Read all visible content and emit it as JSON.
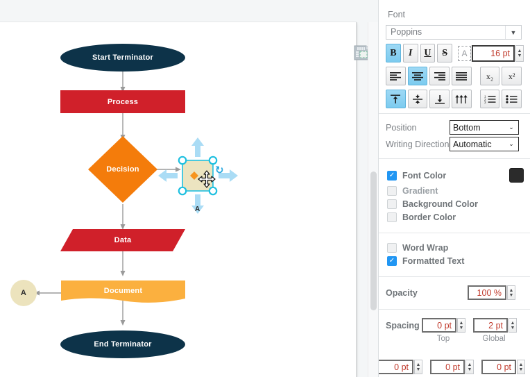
{
  "app": {
    "canvas_icon": "page-grid-icon"
  },
  "diagram": {
    "nodes": [
      {
        "id": "start",
        "label": "Start Terminator",
        "shape": "ellipse",
        "color": "#0d3349"
      },
      {
        "id": "process",
        "label": "Process",
        "shape": "rectangle",
        "color": "#d0202a"
      },
      {
        "id": "decision",
        "label": "Decision",
        "shape": "diamond",
        "color": "#f47c0b"
      },
      {
        "id": "data",
        "label": "Data",
        "shape": "parallelogram",
        "color": "#d0202a"
      },
      {
        "id": "document",
        "label": "Document",
        "shape": "document",
        "color": "#fbb03f"
      },
      {
        "id": "end",
        "label": "End Terminator",
        "shape": "ellipse",
        "color": "#0d3349"
      },
      {
        "id": "connector",
        "label": "A",
        "shape": "circle",
        "color": "#ece3bd"
      }
    ],
    "selection": {
      "label": "A",
      "fill": "#ece4c0",
      "handle_color": "#1fc0e0",
      "arrow_color": "#aadcf5",
      "marker_color": "#f7941e",
      "rotate_glyph": "↻",
      "cursor": "move-cursor"
    }
  },
  "sidebar": {
    "font": {
      "title": "Font",
      "family_value": "Poppins",
      "family_arrow": "▼",
      "style_buttons": [
        {
          "name": "bold",
          "glyph": "B",
          "active": true
        },
        {
          "name": "italic",
          "glyph": "I",
          "active": false
        },
        {
          "name": "underline",
          "glyph": "U",
          "active": false
        },
        {
          "name": "strikethrough",
          "glyph": "S",
          "active": false
        }
      ],
      "auto_size_glyph": "A",
      "size_value": "16 pt",
      "align_buttons": [
        {
          "name": "align-left",
          "active": false
        },
        {
          "name": "align-center",
          "active": true
        },
        {
          "name": "align-right",
          "active": false
        },
        {
          "name": "align-justify",
          "active": false
        }
      ],
      "script_buttons": [
        {
          "name": "subscript",
          "glyph": "x₂"
        },
        {
          "name": "superscript",
          "glyph": "x²"
        }
      ],
      "valign_buttons": [
        {
          "name": "valign-top",
          "active": true
        },
        {
          "name": "valign-middle",
          "active": false
        },
        {
          "name": "valign-bottom",
          "active": false
        },
        {
          "name": "valign-justify",
          "active": false
        }
      ],
      "list_buttons": [
        {
          "name": "numbered-list"
        },
        {
          "name": "bulleted-list"
        }
      ]
    },
    "position": {
      "label": "Position",
      "value": "Bottom",
      "arrow": "⌄"
    },
    "writing_direction": {
      "label": "Writing Direction",
      "value": "Automatic",
      "arrow": "⌄"
    },
    "colors": [
      {
        "label": "Font Color",
        "checked": true,
        "swatch": "#2b2b2b"
      },
      {
        "label": "Gradient",
        "checked": false,
        "swatch": null
      },
      {
        "label": "Background Color",
        "checked": false,
        "swatch": null
      },
      {
        "label": "Border Color",
        "checked": false,
        "swatch": null
      }
    ],
    "text_options": [
      {
        "label": "Word Wrap",
        "checked": false
      },
      {
        "label": "Formatted Text",
        "checked": true
      }
    ],
    "opacity": {
      "label": "Opacity",
      "value": "100 %"
    },
    "spacing": {
      "label": "Spacing",
      "top_value": "0 pt",
      "top_label": "Top",
      "global_value": "2 pt",
      "global_label": "Global",
      "bottom_row": [
        "0 pt",
        "0 pt",
        "0 pt"
      ]
    }
  }
}
